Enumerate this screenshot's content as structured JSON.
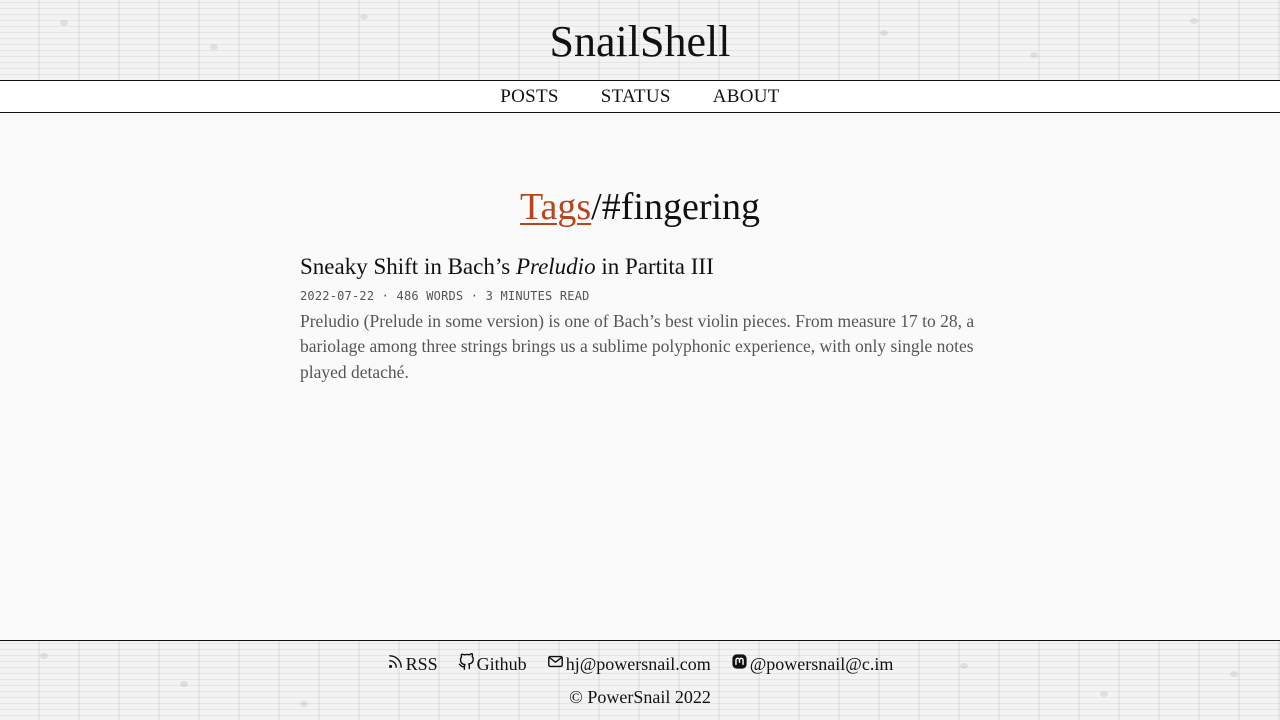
{
  "site": {
    "title": "SnailShell"
  },
  "nav": {
    "items": [
      {
        "label": "POSTS"
      },
      {
        "label": "STATUS"
      },
      {
        "label": "ABOUT"
      }
    ]
  },
  "page": {
    "breadcrumb_link": "Tags",
    "separator": "/",
    "tag": "#fingering"
  },
  "post": {
    "title_prefix": "Sneaky Shift in Bach’s ",
    "title_italic": "Preludio",
    "title_suffix": " in Partita III",
    "meta": "2022-07-22 · 486 WORDS · 3 MINUTES READ",
    "excerpt": "Preludio (Prelude in some version) is one of Bach’s best violin pieces. From measure 17 to 28, a bariolage among three strings brings us a sublime polyphonic experience, with only single notes played detaché."
  },
  "footer": {
    "links": [
      {
        "icon": "rss-icon",
        "label": "RSS"
      },
      {
        "icon": "github-icon",
        "label": "Github"
      },
      {
        "icon": "mail-icon",
        "label": "hj@powersnail.com"
      },
      {
        "icon": "mastodon-icon",
        "label": "@powersnail@c.im"
      }
    ],
    "copyright": "© PowerSnail 2022"
  },
  "colors": {
    "accent": "#b5461e",
    "text": "#111111",
    "muted": "#555555",
    "background": "#fafafa"
  }
}
